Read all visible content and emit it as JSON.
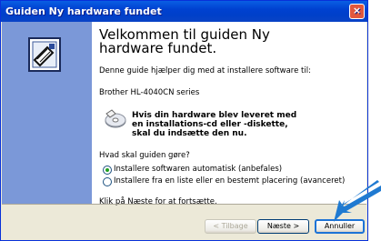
{
  "window": {
    "title": "Guiden Ny hardware fundet",
    "close_symbol": "×"
  },
  "wizard": {
    "heading": "Velkommen til guiden Ny hardware fundet.",
    "intro": "Denne guide hjælper dig med at installere software til:",
    "device": "Brother HL-4040CN series",
    "cd_note": "Hvis din hardware blev leveret med en installations-cd eller -diskette, skal du indsætte den nu.",
    "question": "Hvad skal guiden gøre?",
    "options": [
      {
        "label": "Installere softwaren automatisk (anbefales)",
        "selected": true
      },
      {
        "label": "Installere fra en liste eller en bestemt placering (avanceret)",
        "selected": false
      }
    ],
    "continue_text": "Klik på Næste for at fortsætte."
  },
  "buttons": {
    "back": "< Tilbage",
    "next": "Næste >",
    "cancel": "Annuller"
  },
  "icons": {
    "wizard": "hardware-wizard-icon",
    "cd": "cd-icon",
    "arrow": "pointer-arrow",
    "close": "close-icon"
  },
  "colors": {
    "titlebar": "#0a5fe3",
    "left_panel": "#7b98d8",
    "arrow": "#1f7ad1",
    "radio_selected": "#21a121"
  }
}
